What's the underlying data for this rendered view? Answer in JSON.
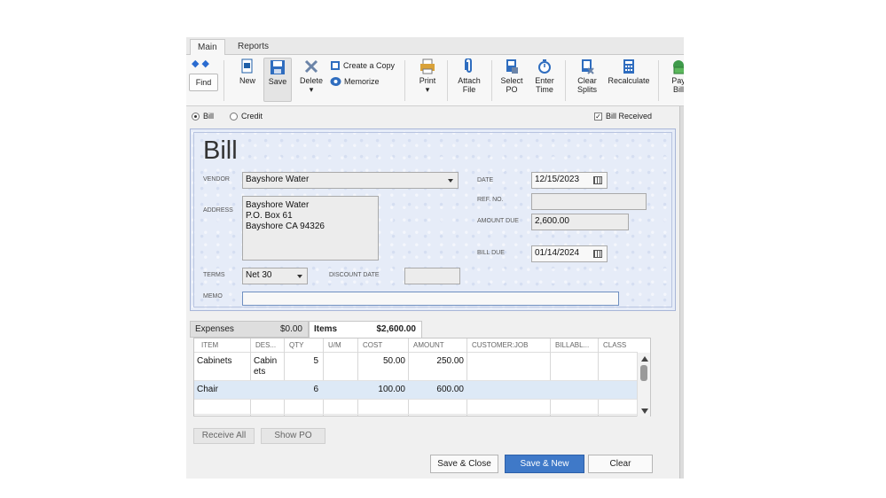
{
  "ribbon": {
    "tabs": [
      "Main",
      "Reports"
    ],
    "find_label": "Find",
    "new_label": "New",
    "save_label": "Save",
    "delete_label": "Delete",
    "create_copy_label": "Create a Copy",
    "memorize_label": "Memorize",
    "print_label": "Print",
    "attach_file_label_1": "Attach",
    "attach_file_label_2": "File",
    "select_po_label_1": "Select",
    "select_po_label_2": "PO",
    "enter_time_label_1": "Enter",
    "enter_time_label_2": "Time",
    "clear_splits_label_1": "Clear",
    "clear_splits_label_2": "Splits",
    "recalculate_label": "Recalculate",
    "pay_bill_label_1": "Pay",
    "pay_bill_label_2": "Bill"
  },
  "options": {
    "bill_radio": "Bill",
    "credit_radio": "Credit",
    "bill_received": "Bill Received",
    "bill_selected": true,
    "bill_received_checked": true
  },
  "bill": {
    "title": "Bill",
    "vendor_label": "VENDOR",
    "vendor": "Bayshore Water",
    "address_label": "ADDRESS",
    "address_lines": [
      "Bayshore Water",
      "P.O. Box 61",
      "Bayshore CA 94326"
    ],
    "terms_label": "TERMS",
    "terms": "Net 30",
    "discount_date_label": "DISCOUNT DATE",
    "discount_date": "",
    "memo_label": "MEMO",
    "memo": "",
    "date_label": "DATE",
    "date": "12/15/2023",
    "ref_no_label": "REF. NO.",
    "ref_no": "",
    "amount_due_label": "AMOUNT DUE",
    "amount_due": "2,600.00",
    "bill_due_label": "BILL DUE",
    "bill_due": "01/14/2024"
  },
  "detail_tabs": {
    "expenses_label": "Expenses",
    "expenses_total": "$0.00",
    "items_label": "Items",
    "items_total": "$2,600.00"
  },
  "items_table": {
    "columns": [
      "ITEM",
      "DES...",
      "QTY",
      "U/M",
      "COST",
      "AMOUNT",
      "CUSTOMER:JOB",
      "BILLABL...",
      "CLASS"
    ],
    "rows": [
      {
        "item": "Cabinets",
        "desc_1": "Cabin",
        "desc_2": "ets",
        "qty": "5",
        "um": "",
        "cost": "50.00",
        "amount": "250.00"
      },
      {
        "item": "Chair",
        "desc_1": "",
        "desc_2": "",
        "qty": "6",
        "um": "",
        "cost": "100.00",
        "amount": "600.00"
      }
    ]
  },
  "grid_buttons": {
    "receive_all": "Receive All",
    "show_po": "Show PO"
  },
  "footer": {
    "save_close": "Save & Close",
    "save_new": "Save & New",
    "clear": "Clear"
  }
}
